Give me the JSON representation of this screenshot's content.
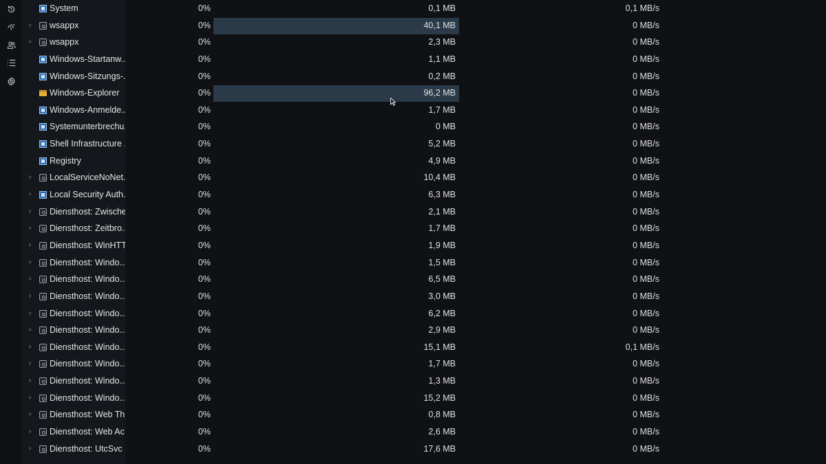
{
  "sidebar": {
    "icons": [
      "history-icon",
      "startup-icon",
      "users-icon",
      "details-icon",
      "services-icon"
    ]
  },
  "colors": {
    "background": "#0f1115",
    "name_column": "#14171b",
    "highlight": "#2a3a49"
  },
  "processes": [
    {
      "name": "System",
      "icon": "app",
      "expand": false,
      "cpu": "0%",
      "mem": "0,1 MB",
      "disk": "0,1 MB/s",
      "hl": false
    },
    {
      "name": "wsappx",
      "icon": "svc",
      "expand": true,
      "cpu": "0%",
      "mem": "40,1 MB",
      "disk": "0 MB/s",
      "hl": true
    },
    {
      "name": "wsappx",
      "icon": "svc",
      "expand": true,
      "cpu": "0%",
      "mem": "2,3 MB",
      "disk": "0 MB/s",
      "hl": false
    },
    {
      "name": "Windows-Startanw...",
      "icon": "app",
      "expand": false,
      "cpu": "0%",
      "mem": "1,1 MB",
      "disk": "0 MB/s",
      "hl": false
    },
    {
      "name": "Windows-Sitzungs-...",
      "icon": "app",
      "expand": false,
      "cpu": "0%",
      "mem": "0,2 MB",
      "disk": "0 MB/s",
      "hl": false
    },
    {
      "name": "Windows-Explorer",
      "icon": "folder",
      "expand": false,
      "cpu": "0%",
      "mem": "96,2 MB",
      "disk": "0 MB/s",
      "hl": true
    },
    {
      "name": "Windows-Anmelde...",
      "icon": "app",
      "expand": false,
      "cpu": "0%",
      "mem": "1,7 MB",
      "disk": "0 MB/s",
      "hl": false
    },
    {
      "name": "Systemunterbrechu...",
      "icon": "app",
      "expand": false,
      "cpu": "0%",
      "mem": "0 MB",
      "disk": "0 MB/s",
      "hl": false
    },
    {
      "name": "Shell Infrastructure ...",
      "icon": "app",
      "expand": false,
      "cpu": "0%",
      "mem": "5,2 MB",
      "disk": "0 MB/s",
      "hl": false
    },
    {
      "name": "Registry",
      "icon": "app",
      "expand": false,
      "cpu": "0%",
      "mem": "4,9 MB",
      "disk": "0 MB/s",
      "hl": false
    },
    {
      "name": "LocalServiceNoNet...",
      "icon": "svc",
      "expand": true,
      "cpu": "0%",
      "mem": "10,4 MB",
      "disk": "0 MB/s",
      "hl": false
    },
    {
      "name": "Local Security Auth...",
      "icon": "app",
      "expand": true,
      "cpu": "0%",
      "mem": "6,3 MB",
      "disk": "0 MB/s",
      "hl": false
    },
    {
      "name": "Diensthost: Zwische...",
      "icon": "svc",
      "expand": true,
      "cpu": "0%",
      "mem": "2,1 MB",
      "disk": "0 MB/s",
      "hl": false
    },
    {
      "name": "Diensthost: Zeitbro...",
      "icon": "svc",
      "expand": true,
      "cpu": "0%",
      "mem": "1,7 MB",
      "disk": "0 MB/s",
      "hl": false
    },
    {
      "name": "Diensthost: WinHTT...",
      "icon": "svc",
      "expand": true,
      "cpu": "0%",
      "mem": "1,9 MB",
      "disk": "0 MB/s",
      "hl": false
    },
    {
      "name": "Diensthost: Windo...",
      "icon": "svc",
      "expand": true,
      "cpu": "0%",
      "mem": "1,5 MB",
      "disk": "0 MB/s",
      "hl": false
    },
    {
      "name": "Diensthost: Windo...",
      "icon": "svc",
      "expand": true,
      "cpu": "0%",
      "mem": "6,5 MB",
      "disk": "0 MB/s",
      "hl": false
    },
    {
      "name": "Diensthost: Windo...",
      "icon": "svc",
      "expand": true,
      "cpu": "0%",
      "mem": "3,0 MB",
      "disk": "0 MB/s",
      "hl": false
    },
    {
      "name": "Diensthost: Windo...",
      "icon": "svc",
      "expand": true,
      "cpu": "0%",
      "mem": "6,2 MB",
      "disk": "0 MB/s",
      "hl": false
    },
    {
      "name": "Diensthost: Windo...",
      "icon": "svc",
      "expand": true,
      "cpu": "0%",
      "mem": "2,9 MB",
      "disk": "0 MB/s",
      "hl": false
    },
    {
      "name": "Diensthost: Windo...",
      "icon": "svc",
      "expand": true,
      "cpu": "0%",
      "mem": "15,1 MB",
      "disk": "0,1 MB/s",
      "hl": false
    },
    {
      "name": "Diensthost: Windo...",
      "icon": "svc",
      "expand": true,
      "cpu": "0%",
      "mem": "1,7 MB",
      "disk": "0 MB/s",
      "hl": false
    },
    {
      "name": "Diensthost: Windo...",
      "icon": "svc",
      "expand": true,
      "cpu": "0%",
      "mem": "1,3 MB",
      "disk": "0 MB/s",
      "hl": false
    },
    {
      "name": "Diensthost: Windo...",
      "icon": "svc",
      "expand": true,
      "cpu": "0%",
      "mem": "15,2 MB",
      "disk": "0 MB/s",
      "hl": false
    },
    {
      "name": "Diensthost: Web Th...",
      "icon": "svc",
      "expand": true,
      "cpu": "0%",
      "mem": "0,8 MB",
      "disk": "0 MB/s",
      "hl": false
    },
    {
      "name": "Diensthost: Web Ac...",
      "icon": "svc",
      "expand": true,
      "cpu": "0%",
      "mem": "2,6 MB",
      "disk": "0 MB/s",
      "hl": false
    },
    {
      "name": "Diensthost: UtcSvc",
      "icon": "svc",
      "expand": true,
      "cpu": "0%",
      "mem": "17,6 MB",
      "disk": "0 MB/s",
      "hl": false
    }
  ]
}
